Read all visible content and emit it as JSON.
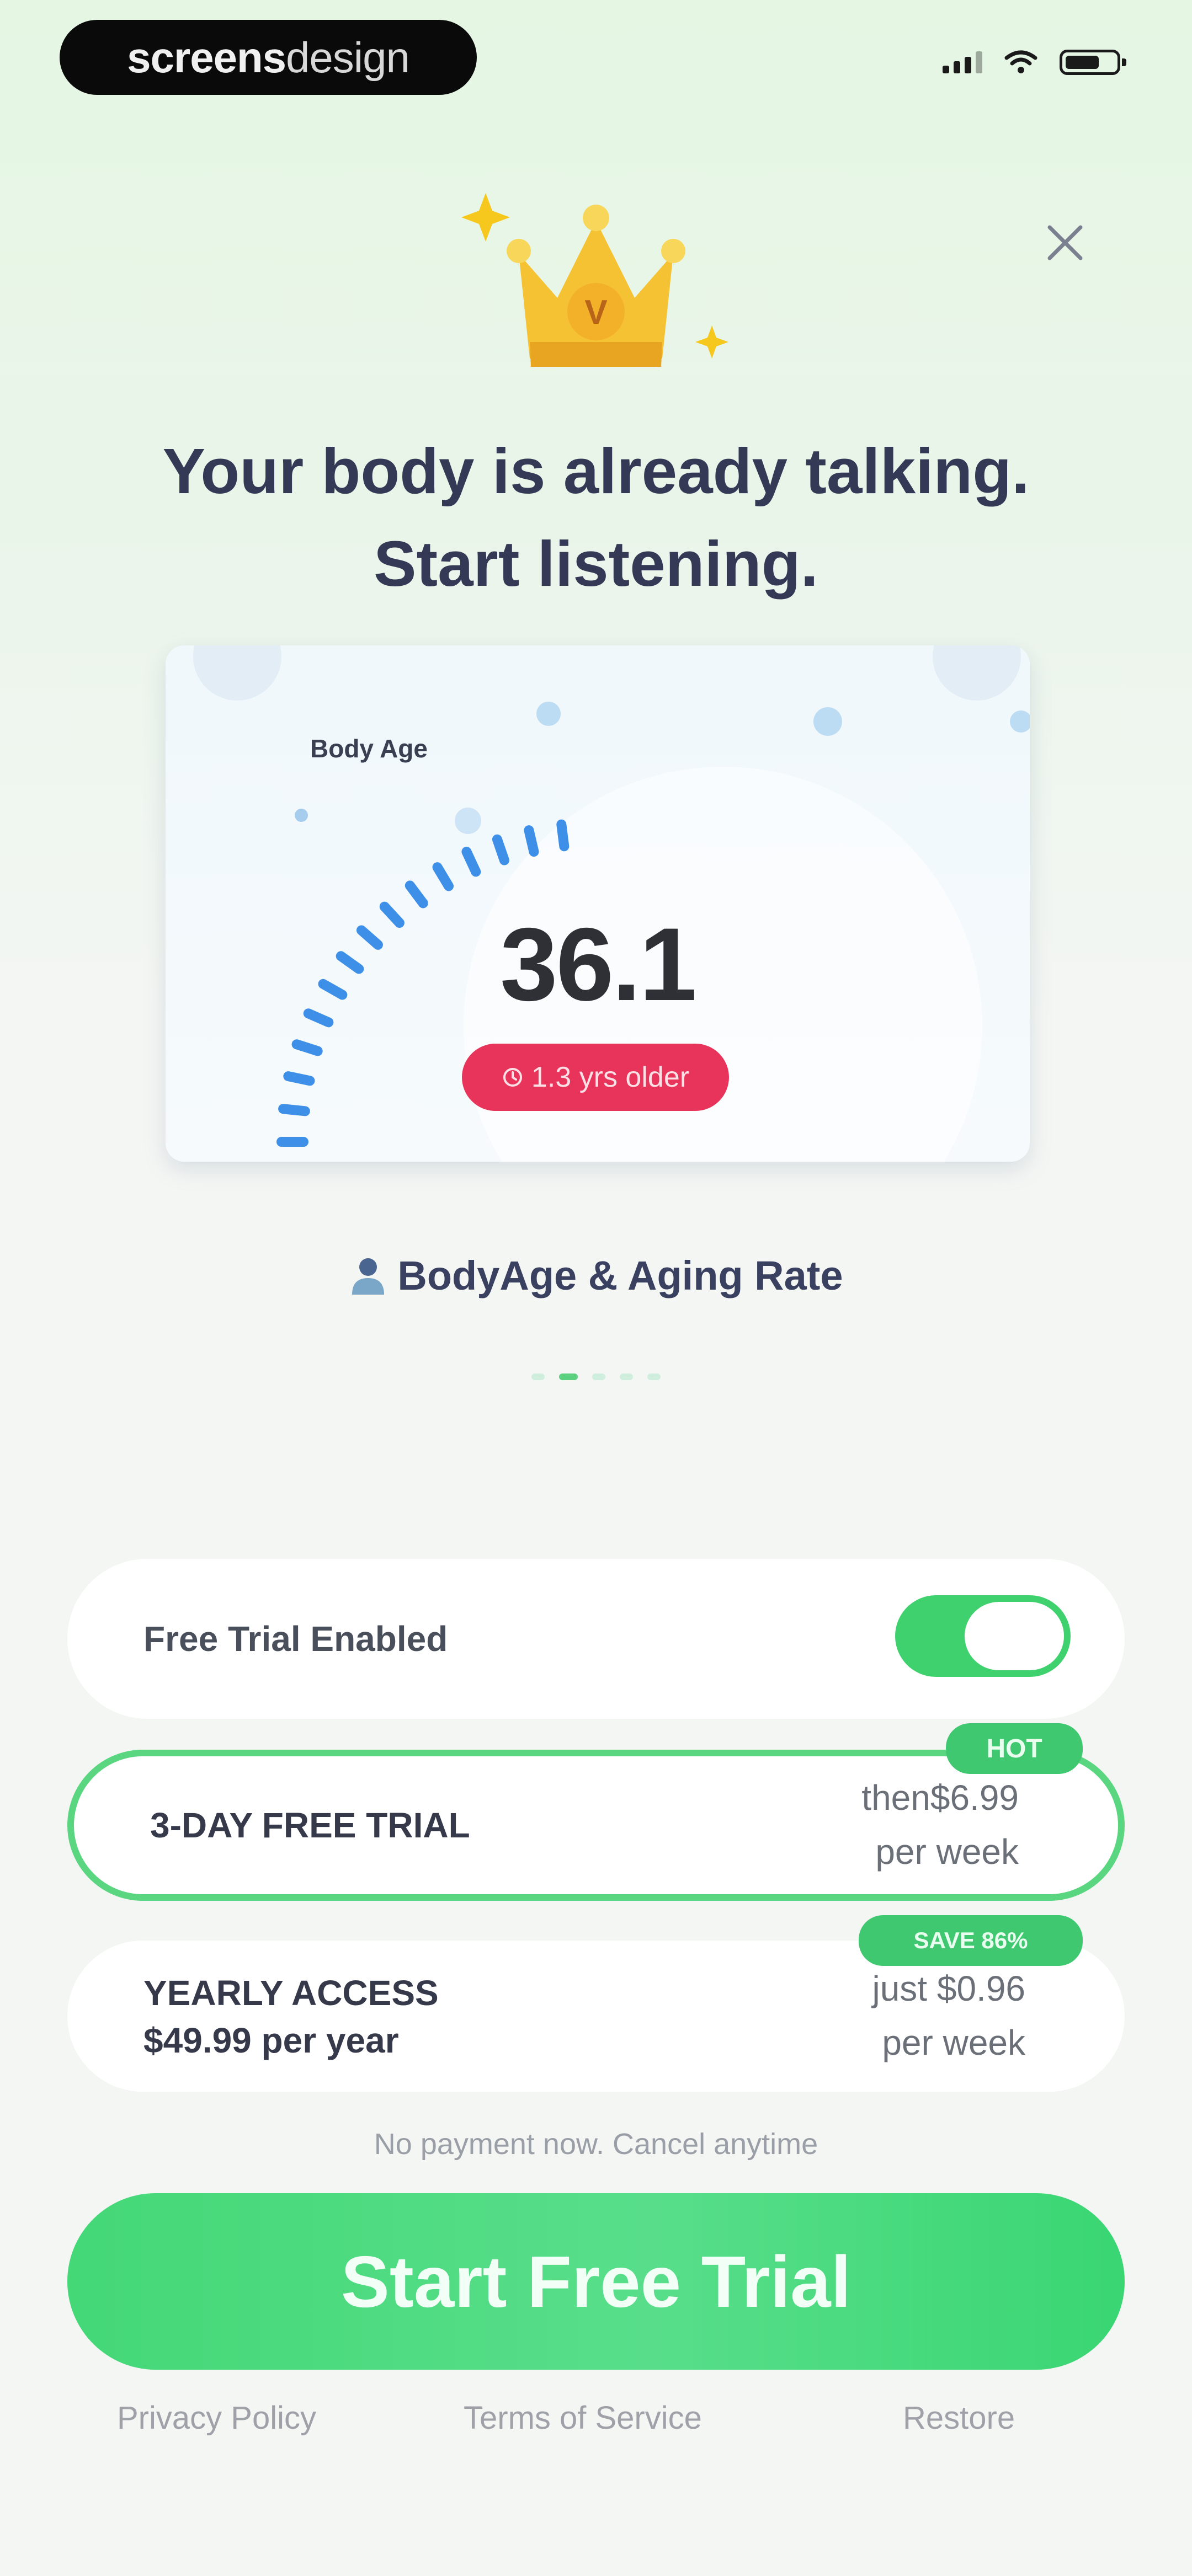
{
  "status_bar": {
    "brand_bold": "screens",
    "brand_light": "design"
  },
  "close_icon": "close-icon",
  "headline": {
    "line1": "Your body is already talking.",
    "line2": "Start listening."
  },
  "card": {
    "label": "Body Age",
    "value": "36.1",
    "badge": "1.3 yrs older",
    "badge_color": "#e8345a"
  },
  "feature": {
    "title": "BodyAge & Aging Rate",
    "icon": "person-icon",
    "page_count": 5,
    "active_page": 2
  },
  "trial_toggle": {
    "label": "Free Trial Enabled",
    "enabled": true
  },
  "plans": [
    {
      "name": "3-DAY FREE TRIAL",
      "name_sub": "",
      "price_line1": "then$6.99",
      "price_line2": "per week",
      "tag": "HOT",
      "selected": true
    },
    {
      "name": "YEARLY ACCESS",
      "name_sub": "$49.99 per year",
      "price_line1": "just $0.96",
      "price_line2": "per week",
      "tag": "SAVE 86%",
      "selected": false
    }
  ],
  "note": "No payment now. Cancel anytime",
  "cta": "Start Free Trial",
  "footer": {
    "privacy": "Privacy Policy",
    "terms": "Terms of Service",
    "restore": "Restore"
  },
  "colors": {
    "accent": "#3fd16d",
    "headline": "#343a56",
    "gauge": "#3d8fe8"
  }
}
